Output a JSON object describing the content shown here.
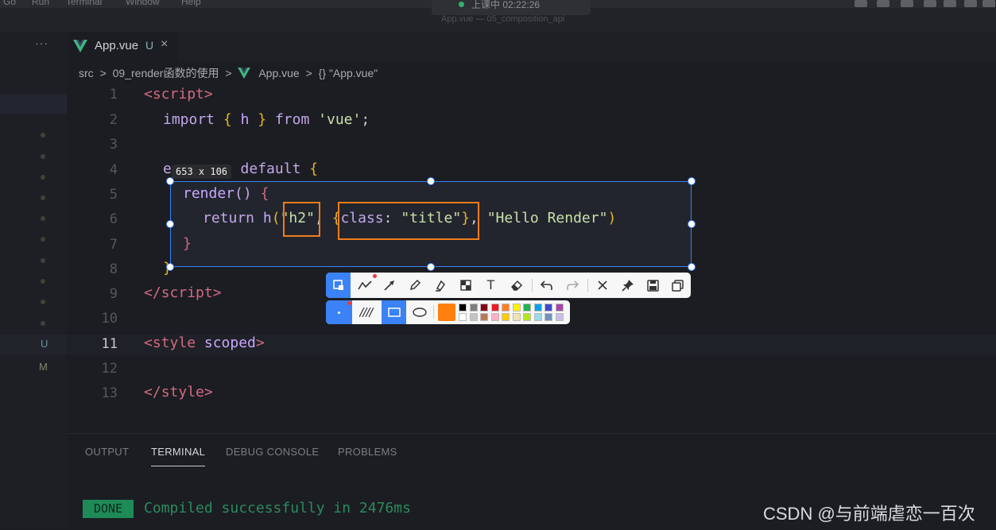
{
  "menubar": {
    "items": [
      "Go",
      "Run",
      "Terminal",
      "Window",
      "Help"
    ]
  },
  "recording": {
    "status": "上课中 02:22:26"
  },
  "window_title": "App.vue — 05_composition_api",
  "activity": {
    "more": "···",
    "gutter_u": "U",
    "gutter_m": "M"
  },
  "tab": {
    "name": "App.vue",
    "status": "U",
    "close": "×"
  },
  "breadcrumb": {
    "src": "src",
    "folder": "09_render函数的使用",
    "file": "App.vue",
    "symbol": "{} \"App.vue\"",
    "sep": ">"
  },
  "editor": {
    "line_numbers": [
      "1",
      "2",
      "3",
      "4",
      "5",
      "6",
      "7",
      "8",
      "9",
      "10",
      "11",
      "12",
      "13"
    ],
    "current_line": "11",
    "lines": {
      "l1_open": "<",
      "l1_tag": "script",
      "l1_close": ">",
      "l2_import": "import",
      "l2_lb": "{",
      "l2_h": "h",
      "l2_rb": "}",
      "l2_from": "from",
      "l2_str": "'vue'",
      "l2_semi": ";",
      "l4_e": "e",
      "l4_default": "default",
      "l4_brace": "{",
      "l5_render": "render",
      "l5_parens": "()",
      "l5_brace": "{",
      "l6_return": "return",
      "l6_h": "h",
      "l6_paren": "(",
      "l6_h2": "\"h2\"",
      "l6_comma": ",",
      "l6_lb": "{",
      "l6_class": "class",
      "l6_colon": ":",
      "l6_title": "\"title\"",
      "l6_rb": "}",
      "l6_comma2": ",",
      "l6_hello": "\"Hello Render\"",
      "l6_rparen": ")",
      "l7_brace": "}",
      "l8_brace": "}",
      "l9_open": "</",
      "l9_tag": "script",
      "l9_close": ">",
      "l11_open": "<",
      "l11_tag": "style",
      "l11_attr": "scoped",
      "l11_close": ">",
      "l13_open": "</",
      "l13_tag": "style",
      "l13_close": ">"
    }
  },
  "panel": {
    "tabs": [
      "OUTPUT",
      "TERMINAL",
      "DEBUG CONSOLE",
      "PROBLEMS"
    ],
    "active_tab": "TERMINAL",
    "done_badge": "DONE",
    "message": "Compiled successfully in 2476ms"
  },
  "capture": {
    "dimensions": "653 x 106"
  },
  "capture_tools": [
    "rectangle-select-icon",
    "polyline-icon",
    "arrow-icon",
    "pencil-icon",
    "marker-icon",
    "mosaic-icon",
    "text-icon",
    "eraser-icon",
    "undo-icon",
    "redo-icon",
    "cancel-icon",
    "pin-icon",
    "save-icon",
    "copy-icon"
  ],
  "capture_options": {
    "selected_color": "#ff7f0f",
    "palette": [
      "#000000",
      "#7f7f7f",
      "#880015",
      "#ed1c24",
      "#ff7f27",
      "#fff200",
      "#22b14c",
      "#00a2e8",
      "#3f48cc",
      "#a349a4",
      "#ffffff",
      "#c3c3c3",
      "#b97a57",
      "#ffaec9",
      "#ffc90e",
      "#efe4b0",
      "#b5e61d",
      "#99d9ea",
      "#7092be",
      "#c8bfe7"
    ]
  },
  "watermark": "CSDN @与前端虐恋一百次",
  "colors": {
    "accent": "#3b82f6",
    "annotation": "#f07c1a",
    "done": "#1e8a57"
  }
}
